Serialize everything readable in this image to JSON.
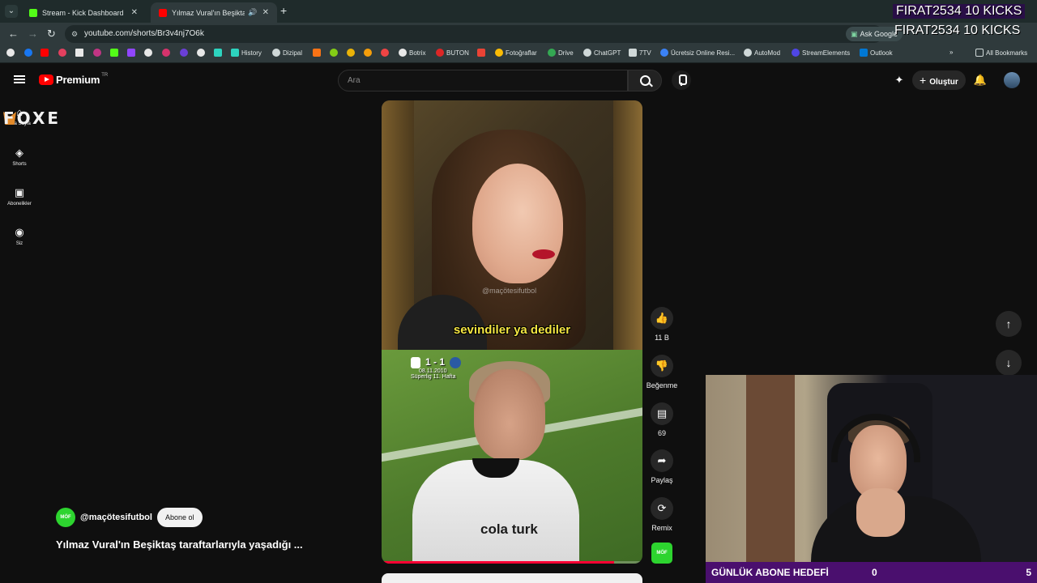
{
  "browser": {
    "tabs": [
      {
        "title": "Stream - Kick Dashboard",
        "favicon_color": "#53fc18"
      },
      {
        "title": "Yılmaz Vural'ın Beşiktaş tara",
        "favicon_color": "#ff0000"
      }
    ],
    "new_tab": "+",
    "url": "youtube.com/shorts/Br3v4nj7O6k",
    "ask_google": "Ask Google",
    "bookmarks": [
      {
        "label": "History"
      },
      {
        "label": "Dizipal"
      },
      {
        "label": "Botrix"
      },
      {
        "label": "BUTON"
      },
      {
        "label": "Fotoğraflar"
      },
      {
        "label": "Drive"
      },
      {
        "label": "ChatGPT"
      },
      {
        "label": "7TV"
      },
      {
        "label": "Ücretsiz Online Resi..."
      },
      {
        "label": "AutoMod"
      },
      {
        "label": "StreamElements"
      },
      {
        "label": "Outlook"
      },
      {
        "label": "All Bookmarks"
      }
    ]
  },
  "youtube": {
    "logo": "Premium",
    "logo_region": "TR",
    "search_placeholder": "Ara",
    "create_label": "Oluştur",
    "sidebar": [
      {
        "label": "Ana Sayfa",
        "icon": "home-icon"
      },
      {
        "label": "Shorts",
        "icon": "shorts-icon"
      },
      {
        "label": "Abonelikler",
        "icon": "subscriptions-icon"
      },
      {
        "label": "Siz",
        "icon": "you-icon"
      }
    ],
    "short": {
      "caption": "sevindiler ya dediler",
      "watermark": "@maçötesifutbol",
      "score": "1 - 1",
      "date": "08.11.2010",
      "league": "Süperlig 11. Hafta",
      "sponsor": "cola turk",
      "progress": 0.89
    },
    "actions": {
      "like_count": "11 B",
      "dislike_label": "Beğenme",
      "comment_count": "69",
      "share_label": "Paylaş",
      "remix_label": "Remix"
    },
    "channel": {
      "handle": "@maçötesifutbol",
      "avatar_text": "MÖF",
      "subscribe_label": "Abone ol"
    },
    "title": "Yılmaz Vural'ın Beşiktaş taraftarlarıyla yaşadığı ..."
  },
  "overlay": {
    "brand": "FOXE",
    "kicks_line1": "FIRAT2534  10 KICKS",
    "kicks_line2": "FIRAT2534  10 KICKS",
    "goal_label": "GÜNLÜK ABONE HEDEFİ",
    "goal_current": "0",
    "goal_target": "5"
  }
}
